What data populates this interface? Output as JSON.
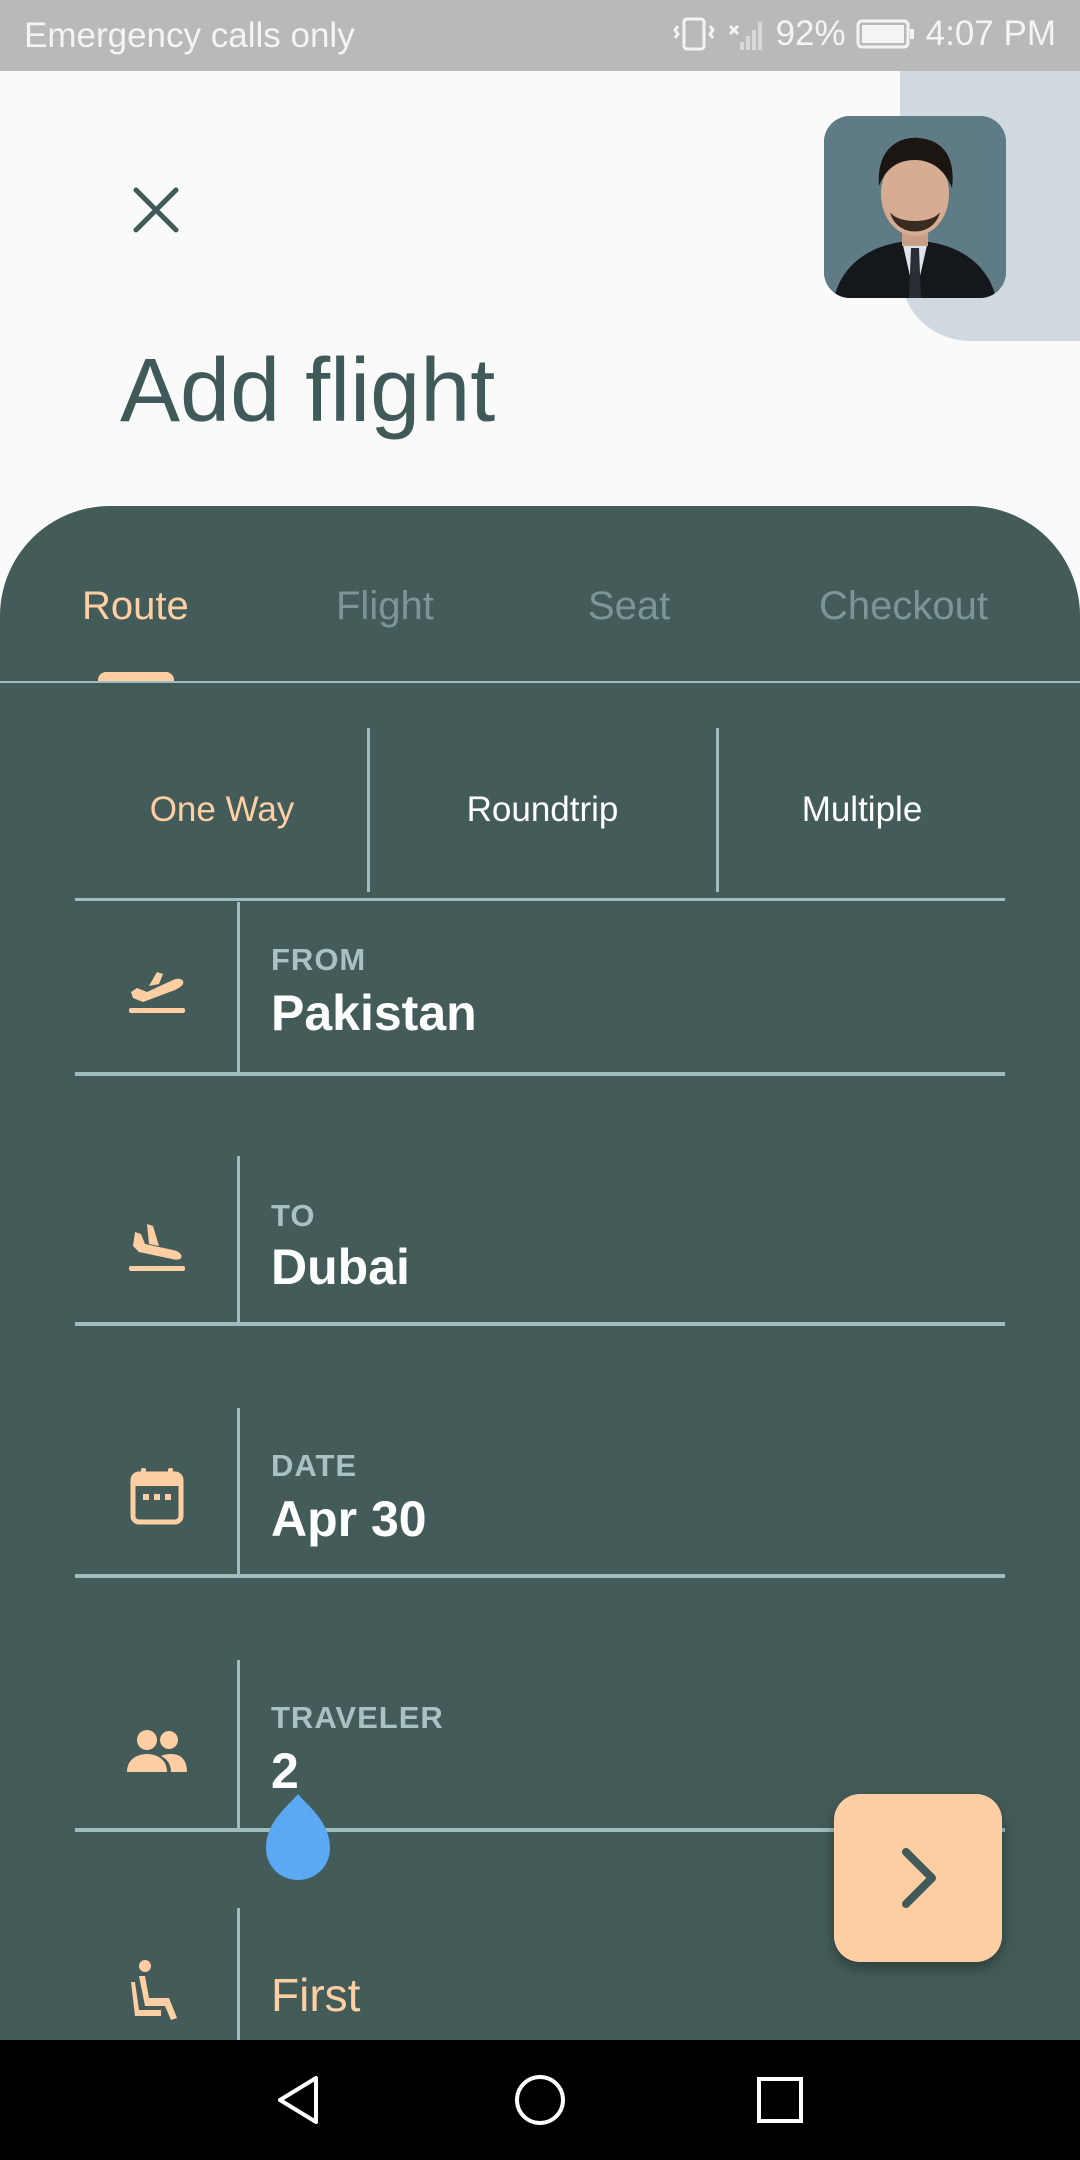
{
  "status_bar": {
    "left_text": "Emergency calls only",
    "battery": "92%",
    "time": "4:07 PM"
  },
  "header": {
    "title": "Add flight"
  },
  "tabs": [
    {
      "label": "Route",
      "active": true
    },
    {
      "label": "Flight",
      "active": false
    },
    {
      "label": "Seat",
      "active": false
    },
    {
      "label": "Checkout",
      "active": false
    }
  ],
  "trip_type": {
    "options": [
      "One Way",
      "Roundtrip",
      "Multiple"
    ],
    "selected": "One Way"
  },
  "fields": {
    "from": {
      "label": "FROM",
      "value": "Pakistan",
      "icon": "flight-takeoff-icon"
    },
    "to": {
      "label": "TO",
      "value": "Dubai",
      "icon": "flight-land-icon"
    },
    "date": {
      "label": "DATE",
      "value": "Apr 30",
      "icon": "calendar-icon"
    },
    "traveler": {
      "label": "TRAVELER",
      "value": "2",
      "icon": "people-icon"
    },
    "class": {
      "value": "First",
      "icon": "seat-icon"
    }
  },
  "colors": {
    "panel": "#435c5a",
    "accent": "#ffcfa3",
    "slider_thumb": "#5aa9f2",
    "title": "#3f5a58"
  }
}
